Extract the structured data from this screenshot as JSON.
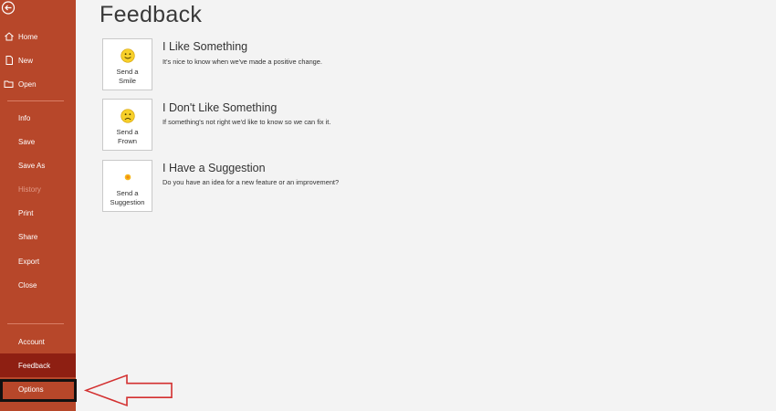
{
  "sidebar": {
    "items": [
      {
        "label": "Home"
      },
      {
        "label": "New"
      },
      {
        "label": "Open"
      },
      {
        "label": "Info"
      },
      {
        "label": "Save"
      },
      {
        "label": "Save As"
      },
      {
        "label": "History"
      },
      {
        "label": "Print"
      },
      {
        "label": "Share"
      },
      {
        "label": "Export"
      },
      {
        "label": "Close"
      },
      {
        "label": "Account"
      },
      {
        "label": "Feedback"
      },
      {
        "label": "Options"
      }
    ],
    "selected": "Feedback",
    "disabled": [
      "History"
    ]
  },
  "main": {
    "title": "Feedback",
    "options": [
      {
        "card_label_1": "Send a",
        "card_label_2": "Smile",
        "icon": "smile-icon",
        "title": "I Like Something",
        "desc": "It's nice to know when we've made a positive change."
      },
      {
        "card_label_1": "Send a",
        "card_label_2": "Frown",
        "icon": "frown-icon",
        "title": "I Don't Like Something",
        "desc": "If something's not right we'd like to know so we can fix it."
      },
      {
        "card_label_1": "Send a",
        "card_label_2": "Suggestion",
        "icon": "lightbulb-icon",
        "title": "I Have a Suggestion",
        "desc": "Do you have an idea for a new feature or an improvement?"
      }
    ]
  },
  "colors": {
    "sidebar": "#b7472a",
    "sidebar_selected": "#8e1f12",
    "background": "#f3f3f3",
    "annotation_arrow": "#d32f2f"
  }
}
